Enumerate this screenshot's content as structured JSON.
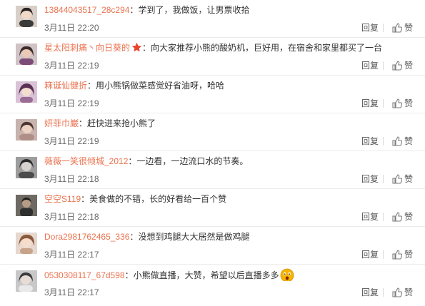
{
  "comments": [
    {
      "user": "13844043517_28c294",
      "text": "学到了，我做饭，让男票收拾",
      "time": "3月11日 22:20",
      "badge": null,
      "emoji": null
    },
    {
      "user": "星太阳刺痛丶向日葵的",
      "text": "向大家推荐小熊的酸奶机，巨好用，在宿舍和家里都买了一台",
      "time": "3月11日 22:19",
      "badge": "star-icon",
      "emoji": null
    },
    {
      "user": "箖诞仙健折",
      "text": "用小熊锅做菜感觉好省油呀，哈哈",
      "time": "3月11日 22:19",
      "badge": null,
      "emoji": null
    },
    {
      "user": "妍菲巾巌",
      "text": "赶快进来抢小熊了",
      "time": "3月11日 22:19",
      "badge": null,
      "emoji": null
    },
    {
      "user": "薇薇一笑很倾城_2012",
      "text": "一边看，一边流口水的节奏。",
      "time": "3月11日 22:18",
      "badge": null,
      "emoji": null
    },
    {
      "user": "空空S119",
      "text": "美食做的不错，长的好看给一百个赞",
      "time": "3月11日 22:18",
      "badge": null,
      "emoji": null
    },
    {
      "user": "Dora2981762465_336",
      "text": "没想到鸡腿大大居然是做鸡腿",
      "time": "3月11日 22:17",
      "badge": null,
      "emoji": null
    },
    {
      "user": "0530308117_67d598",
      "text": "小熊做直播，大赞，希望以后直播多多",
      "time": "3月11日 22:17",
      "badge": null,
      "emoji": "surprised-face-icon"
    }
  ],
  "labels": {
    "colon": "：",
    "reply": "回复",
    "like": "赞"
  },
  "colors": {
    "username": "#eb7350",
    "text": "#333333",
    "meta": "#666666",
    "badge": "#e8472c",
    "emoji": "#f5b400"
  },
  "avatar_icons": [
    "avatar-icon",
    "avatar-icon",
    "avatar-icon",
    "avatar-icon",
    "avatar-icon",
    "avatar-icon",
    "avatar-icon",
    "avatar-icon"
  ]
}
